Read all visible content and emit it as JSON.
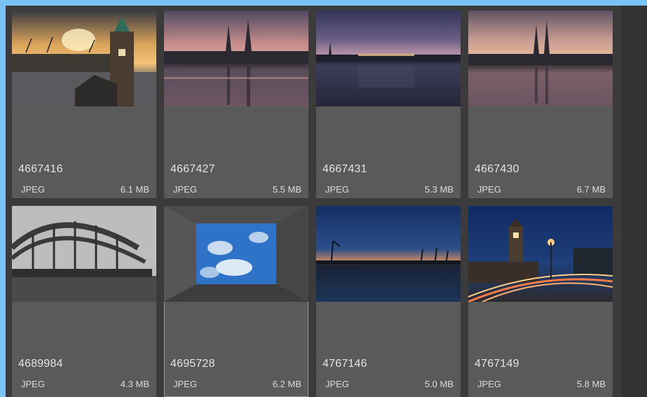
{
  "items": [
    {
      "name": "4667416",
      "type": "JPEG",
      "size": "6.1 MB"
    },
    {
      "name": "4667427",
      "type": "JPEG",
      "size": "5.5 MB"
    },
    {
      "name": "4667431",
      "type": "JPEG",
      "size": "5.3 MB"
    },
    {
      "name": "4667430",
      "type": "JPEG",
      "size": "6.7 MB"
    },
    {
      "name": "4689984",
      "type": "JPEG",
      "size": "4.3 MB"
    },
    {
      "name": "4695728",
      "type": "JPEG",
      "size": "6.2 MB"
    },
    {
      "name": "4767146",
      "type": "JPEG",
      "size": "5.0 MB"
    },
    {
      "name": "4767149",
      "type": "JPEG",
      "size": "5.8 MB"
    }
  ],
  "colors": {
    "outer_background": "#79c3f5",
    "grid_background": "#3b3b3b",
    "card_background": "#5a5a5a",
    "text": "#e4e4e4"
  }
}
